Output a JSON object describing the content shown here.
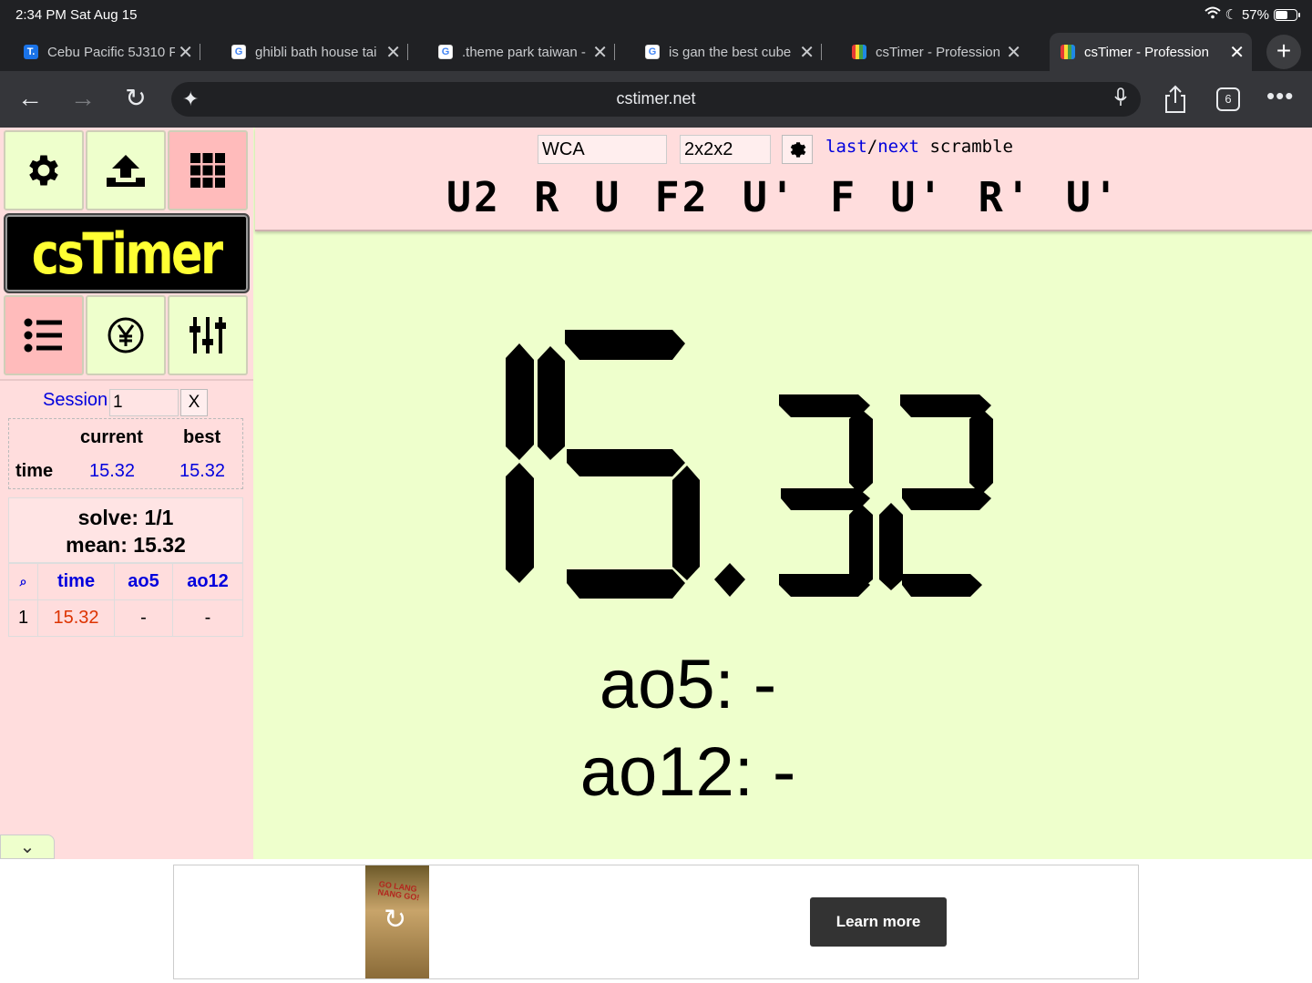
{
  "status_bar": {
    "time": "2:34 PM  Sat Aug 15",
    "battery": "57%"
  },
  "tabs": [
    {
      "title": "Cebu Pacific 5J310 F",
      "favicon": "T."
    },
    {
      "title": "ghibli bath house tai",
      "favicon": "G"
    },
    {
      "title": ".theme park taiwan -",
      "favicon": "G"
    },
    {
      "title": "is gan the best cube",
      "favicon": "G"
    },
    {
      "title": "csTimer - Profession",
      "favicon": ""
    },
    {
      "title": "csTimer - Profession",
      "favicon": ""
    }
  ],
  "toolbar": {
    "url": "cstimer.net",
    "tab_count": "6"
  },
  "cstimer": {
    "logo": "csTimer",
    "scramble_type": "WCA",
    "puzzle": "2x2x2",
    "link_last": "last",
    "link_slash": "/",
    "link_next": "next",
    "link_suffix": "scramble",
    "scramble": "U2 R U F2 U' F U' R' U'",
    "timer": "15.32",
    "ao5_line": "ao5: -",
    "ao12_line": "ao12: -",
    "session": {
      "label": "Session",
      "value": "1",
      "clear": "X",
      "col_current": "current",
      "col_best": "best",
      "row_label": "time",
      "current_time": "15.32",
      "best_time": "15.32",
      "solve_line": "solve: 1/1",
      "mean_line": "mean: 15.32"
    },
    "table": {
      "headers": [
        "⌕",
        "time",
        "ao5",
        "ao12"
      ],
      "rows": [
        {
          "index": "1",
          "time": "15.32",
          "ao5": "-",
          "ao12": "-"
        }
      ]
    },
    "colors": {
      "panel": "#ffdddd",
      "background": "#eeffcc",
      "link": "#0000dd",
      "best_time": "#dd3300"
    }
  },
  "ad": {
    "cta": "Learn more",
    "image_text": "GO LANG NANG GO!"
  }
}
